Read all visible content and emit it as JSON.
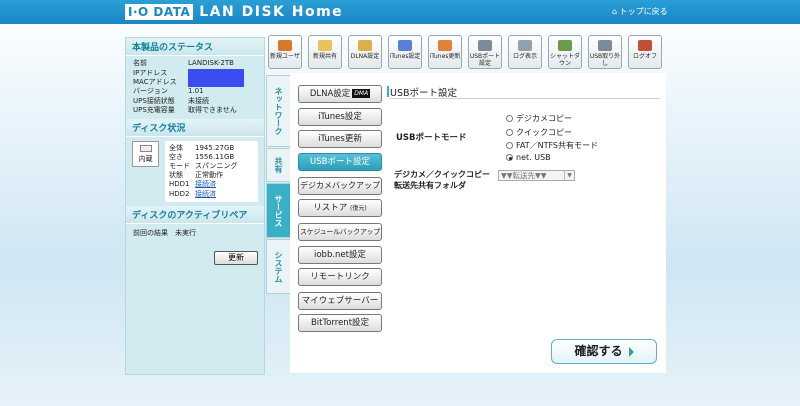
{
  "header": {
    "brand": "I·O DATA",
    "product": "LAN DISK Home",
    "top_link": "トップに戻る"
  },
  "status": {
    "title": "本製品のステータス",
    "rows": [
      {
        "k": "名前",
        "v": "LANDISK-2TB"
      },
      {
        "k": "IPアドレス",
        "v": ""
      },
      {
        "k": "MACアドレス",
        "v": ""
      },
      {
        "k": "バージョン",
        "v": "1.01"
      },
      {
        "k": "UPS接続状態",
        "v": "未接続"
      },
      {
        "k": "UPS充電容量",
        "v": "取得できません"
      }
    ]
  },
  "disk": {
    "title": "ディスク状況",
    "icon_label": "内蔵",
    "rows": [
      {
        "k": "全体",
        "v": "1945.27GB"
      },
      {
        "k": "空き",
        "v": "1556.11GB"
      },
      {
        "k": "モード",
        "v": "スパンニング"
      },
      {
        "k": "状態",
        "v": "正常動作"
      },
      {
        "k": "HDD1",
        "v": "接続済"
      },
      {
        "k": "HDD2",
        "v": "接続済"
      }
    ]
  },
  "repair": {
    "title": "ディスクのアクティブリペア",
    "label": "前回の結果",
    "value": "未実行",
    "button": "更新"
  },
  "toolbar": [
    {
      "label": "新規ユーザ",
      "icon": "add-user-icon",
      "color": "#d9772b"
    },
    {
      "label": "新規共有",
      "icon": "folder-icon",
      "color": "#e8c25a"
    },
    {
      "label": "DLNA設定",
      "icon": "dlna-folder-icon",
      "color": "#d9b04a"
    },
    {
      "label": "iTunes設定",
      "icon": "music-note-icon",
      "color": "#5a7fd6"
    },
    {
      "label": "iTunes更新",
      "icon": "music-refresh-icon",
      "color": "#e0803a"
    },
    {
      "label": "USBポート設定",
      "icon": "usb-icon",
      "color": "#7a8a98"
    },
    {
      "label": "ログ表示",
      "icon": "log-icon",
      "color": "#8fa0ae"
    },
    {
      "label": "シャットダウン",
      "icon": "shutdown-icon",
      "color": "#6a9b4a"
    },
    {
      "label": "USB取り外し",
      "icon": "usb-eject-icon",
      "color": "#7a8a98"
    },
    {
      "label": "ログオフ",
      "icon": "logoff-icon",
      "color": "#c0503a"
    }
  ],
  "tabs": [
    {
      "label": "ネットワーク"
    },
    {
      "label": "共有"
    },
    {
      "label": "サービス"
    },
    {
      "label": "システム"
    }
  ],
  "menu": [
    {
      "label": "DLNA設定",
      "badge": "DMA"
    },
    {
      "label": "iTunes設定"
    },
    {
      "label": "iTunes更新"
    },
    {
      "label": "USBポート設定"
    },
    {
      "label": "デジカメバックアップ"
    },
    {
      "label": "リストア",
      "note": "(復元)"
    },
    {
      "label": "スケジュールバックアップ"
    },
    {
      "label": "iobb.net設定"
    },
    {
      "label": "リモートリンク"
    },
    {
      "label": "マイウェブサーバー"
    },
    {
      "label": "BitTorrent設定"
    }
  ],
  "content": {
    "title": "USBポート設定",
    "mode_label": "USBポートモード",
    "modes": [
      "デジカメコピー",
      "クイックコピー",
      "FAT／NTFS共有モード",
      "net. USB"
    ],
    "selected_mode": 3,
    "folder_label_1": "デジカメ／クイックコピー",
    "folder_label_2": "転送先共有フォルダ",
    "folder_value": "▼▼転送先▼▼",
    "confirm": "確認する"
  }
}
